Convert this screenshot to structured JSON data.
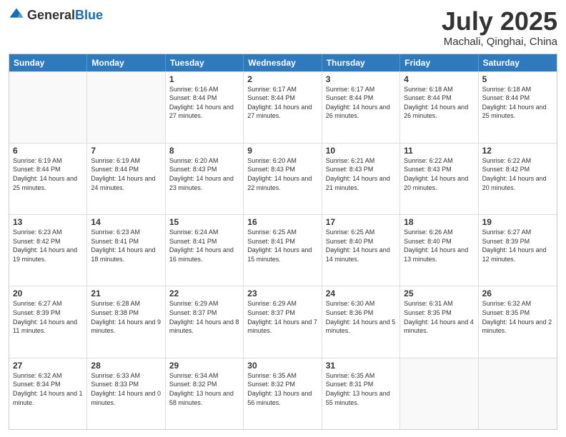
{
  "header": {
    "logo": {
      "general": "General",
      "blue": "Blue"
    },
    "month": "July 2025",
    "location": "Machali, Qinghai, China"
  },
  "calendar": {
    "days": [
      "Sunday",
      "Monday",
      "Tuesday",
      "Wednesday",
      "Thursday",
      "Friday",
      "Saturday"
    ],
    "rows": [
      [
        {
          "date": "",
          "empty": true
        },
        {
          "date": "",
          "empty": true
        },
        {
          "date": "1",
          "sunrise": "6:16 AM",
          "sunset": "8:44 PM",
          "daylight": "14 hours and 27 minutes."
        },
        {
          "date": "2",
          "sunrise": "6:17 AM",
          "sunset": "8:44 PM",
          "daylight": "14 hours and 27 minutes."
        },
        {
          "date": "3",
          "sunrise": "6:17 AM",
          "sunset": "8:44 PM",
          "daylight": "14 hours and 26 minutes."
        },
        {
          "date": "4",
          "sunrise": "6:18 AM",
          "sunset": "8:44 PM",
          "daylight": "14 hours and 26 minutes."
        },
        {
          "date": "5",
          "sunrise": "6:18 AM",
          "sunset": "8:44 PM",
          "daylight": "14 hours and 25 minutes."
        }
      ],
      [
        {
          "date": "6",
          "sunrise": "6:19 AM",
          "sunset": "8:44 PM",
          "daylight": "14 hours and 25 minutes."
        },
        {
          "date": "7",
          "sunrise": "6:19 AM",
          "sunset": "8:44 PM",
          "daylight": "14 hours and 24 minutes."
        },
        {
          "date": "8",
          "sunrise": "6:20 AM",
          "sunset": "8:43 PM",
          "daylight": "14 hours and 23 minutes."
        },
        {
          "date": "9",
          "sunrise": "6:20 AM",
          "sunset": "8:43 PM",
          "daylight": "14 hours and 22 minutes."
        },
        {
          "date": "10",
          "sunrise": "6:21 AM",
          "sunset": "8:43 PM",
          "daylight": "14 hours and 21 minutes."
        },
        {
          "date": "11",
          "sunrise": "6:22 AM",
          "sunset": "8:43 PM",
          "daylight": "14 hours and 20 minutes."
        },
        {
          "date": "12",
          "sunrise": "6:22 AM",
          "sunset": "8:42 PM",
          "daylight": "14 hours and 20 minutes."
        }
      ],
      [
        {
          "date": "13",
          "sunrise": "6:23 AM",
          "sunset": "8:42 PM",
          "daylight": "14 hours and 19 minutes."
        },
        {
          "date": "14",
          "sunrise": "6:23 AM",
          "sunset": "8:41 PM",
          "daylight": "14 hours and 18 minutes."
        },
        {
          "date": "15",
          "sunrise": "6:24 AM",
          "sunset": "8:41 PM",
          "daylight": "14 hours and 16 minutes."
        },
        {
          "date": "16",
          "sunrise": "6:25 AM",
          "sunset": "8:41 PM",
          "daylight": "14 hours and 15 minutes."
        },
        {
          "date": "17",
          "sunrise": "6:25 AM",
          "sunset": "8:40 PM",
          "daylight": "14 hours and 14 minutes."
        },
        {
          "date": "18",
          "sunrise": "6:26 AM",
          "sunset": "8:40 PM",
          "daylight": "14 hours and 13 minutes."
        },
        {
          "date": "19",
          "sunrise": "6:27 AM",
          "sunset": "8:39 PM",
          "daylight": "14 hours and 12 minutes."
        }
      ],
      [
        {
          "date": "20",
          "sunrise": "6:27 AM",
          "sunset": "8:39 PM",
          "daylight": "14 hours and 11 minutes."
        },
        {
          "date": "21",
          "sunrise": "6:28 AM",
          "sunset": "8:38 PM",
          "daylight": "14 hours and 9 minutes."
        },
        {
          "date": "22",
          "sunrise": "6:29 AM",
          "sunset": "8:37 PM",
          "daylight": "14 hours and 8 minutes."
        },
        {
          "date": "23",
          "sunrise": "6:29 AM",
          "sunset": "8:37 PM",
          "daylight": "14 hours and 7 minutes."
        },
        {
          "date": "24",
          "sunrise": "6:30 AM",
          "sunset": "8:36 PM",
          "daylight": "14 hours and 5 minutes."
        },
        {
          "date": "25",
          "sunrise": "6:31 AM",
          "sunset": "8:35 PM",
          "daylight": "14 hours and 4 minutes."
        },
        {
          "date": "26",
          "sunrise": "6:32 AM",
          "sunset": "8:35 PM",
          "daylight": "14 hours and 2 minutes."
        }
      ],
      [
        {
          "date": "27",
          "sunrise": "6:32 AM",
          "sunset": "8:34 PM",
          "daylight": "14 hours and 1 minute."
        },
        {
          "date": "28",
          "sunrise": "6:33 AM",
          "sunset": "8:33 PM",
          "daylight": "14 hours and 0 minutes."
        },
        {
          "date": "29",
          "sunrise": "6:34 AM",
          "sunset": "8:32 PM",
          "daylight": "13 hours and 58 minutes."
        },
        {
          "date": "30",
          "sunrise": "6:35 AM",
          "sunset": "8:32 PM",
          "daylight": "13 hours and 56 minutes."
        },
        {
          "date": "31",
          "sunrise": "6:35 AM",
          "sunset": "8:31 PM",
          "daylight": "13 hours and 55 minutes."
        },
        {
          "date": "",
          "empty": true
        },
        {
          "date": "",
          "empty": true
        }
      ]
    ]
  }
}
